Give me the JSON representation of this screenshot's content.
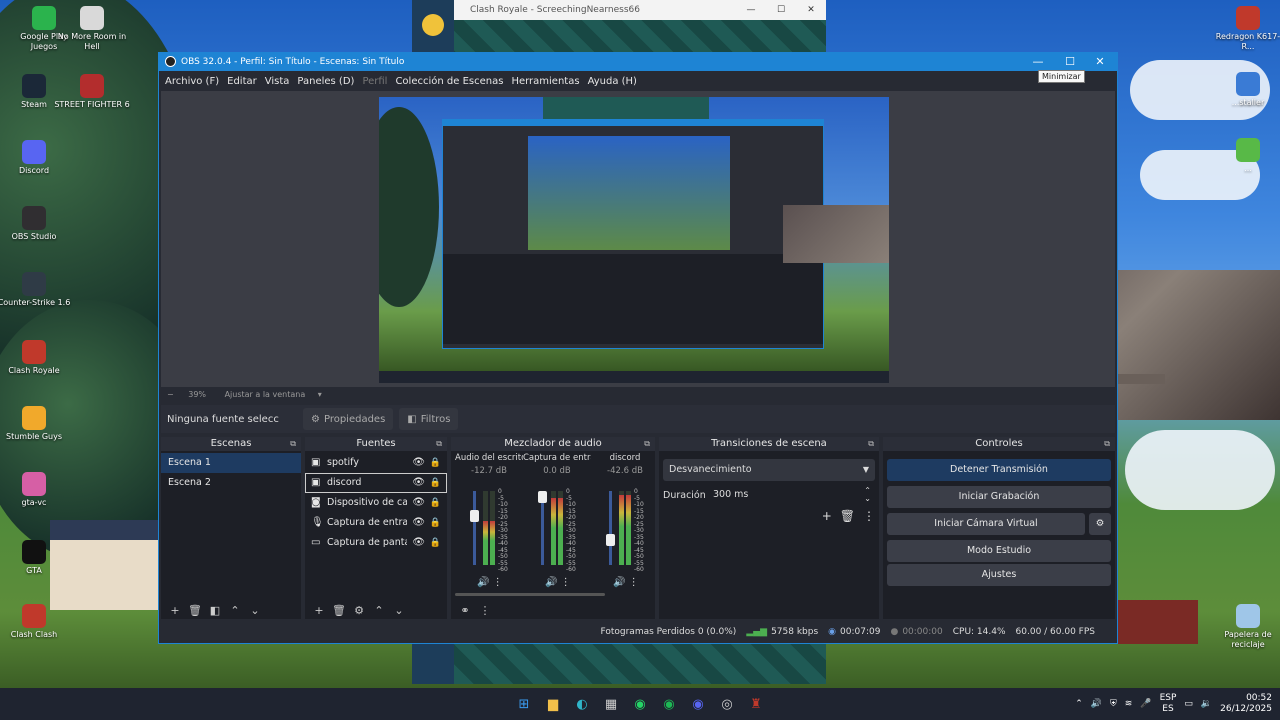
{
  "desktop": {
    "icons_left": [
      {
        "label": "Google Play Juegos",
        "icon": "google-play-games-icon",
        "color": "#2bb34d"
      },
      {
        "label": "No More Room in Hell",
        "icon": "nmrih-icon",
        "color": "#d9d9d9"
      },
      {
        "label": "Steam",
        "icon": "steam-icon",
        "color": "#1b2838"
      },
      {
        "label": "STREET FIGHTER 6",
        "icon": "street-fighter-icon",
        "color": "#b32d2d"
      },
      {
        "label": "Discord",
        "icon": "discord-icon",
        "color": "#5865f2"
      },
      {
        "label": "OBS Studio",
        "icon": "obs-icon",
        "color": "#302e31"
      },
      {
        "label": "Counter-Strike 1.6",
        "icon": "counter-strike-icon",
        "color": "#2f3b46"
      },
      {
        "label": "Clash Royale",
        "icon": "clash-royale-icon",
        "color": "#c0392b"
      },
      {
        "label": "Stumble Guys",
        "icon": "stumble-guys-icon",
        "color": "#f1a92b"
      },
      {
        "label": "gta-vc",
        "icon": "gta-vc-icon",
        "color": "#d65fa5"
      },
      {
        "label": "GTA",
        "icon": "gta-icon",
        "color": "#111111"
      },
      {
        "label": "Clash Clash",
        "icon": "clash-icon",
        "color": "#c0392b"
      }
    ],
    "icons_right": [
      {
        "label": "Redragon K617-R...",
        "icon": "redragon-icon",
        "color": "#c0392b"
      },
      {
        "label": "...staller",
        "icon": "installer-icon",
        "color": "#3a7bd5"
      },
      {
        "label": "...",
        "icon": "utorrent-icon",
        "color": "#58b947"
      },
      {
        "label": "Papelera de reciclaje",
        "icon": "recycle-bin-icon",
        "color": "#9fc6e8"
      }
    ]
  },
  "clash_window": {
    "title": "Clash Royale - ScreechingNearness66",
    "minimize": "—",
    "maximize": "☐",
    "close": "✕"
  },
  "obs": {
    "title": "OBS 32.0.4 - Perfil: Sin Título - Escenas: Sin Título",
    "window_buttons": {
      "minimize": "—",
      "maximize": "☐",
      "close": "✕"
    },
    "tooltip": "Minimizar",
    "menu": [
      "Archivo (F)",
      "Editar",
      "Vista",
      "Paneles (D)",
      "Perfil",
      "Colección de Escenas",
      "Herramientas",
      "Ayuda (H)"
    ],
    "zoom": {
      "minus": "−",
      "percent": "39%",
      "fit": "Ajustar a la ventana"
    },
    "source_toolbar": {
      "no_source": "Ninguna fuente seleccionada",
      "properties": "Propiedades",
      "filters": "Filtros"
    },
    "scenes": {
      "header": "Escenas",
      "items": [
        "Escena 1",
        "Escena 2"
      ],
      "selected": "Escena 1"
    },
    "sources": {
      "header": "Fuentes",
      "items": [
        {
          "label": "spotify",
          "icon": "window-capture-icon"
        },
        {
          "label": "discord",
          "icon": "window-capture-icon"
        },
        {
          "label": "Dispositivo de captura",
          "icon": "camera-icon"
        },
        {
          "label": "Captura de entrada de audio",
          "icon": "microphone-icon"
        },
        {
          "label": "Captura de pantalla",
          "icon": "monitor-icon"
        }
      ],
      "selected": "discord"
    },
    "mixer": {
      "header": "Mezclador de audio",
      "channels": [
        {
          "name": "Audio del escritorio",
          "db": "-12.7 dB",
          "level": 0.6,
          "fader": 0.7
        },
        {
          "name": "Captura de entrada",
          "db": "0.0 dB",
          "level": 0.9,
          "fader": 1.0
        },
        {
          "name": "discord",
          "db": "-42.6 dB",
          "level": 0.95,
          "fader": 0.3
        }
      ],
      "scale": [
        "0",
        "-5",
        "-10",
        "-15",
        "-20",
        "-25",
        "-30",
        "-35",
        "-40",
        "-45",
        "-50",
        "-55",
        "-60"
      ]
    },
    "transitions": {
      "header": "Transiciones de escena",
      "selected": "Desvanecimiento",
      "duration_label": "Duración",
      "duration_value": "300 ms"
    },
    "controls": {
      "header": "Controles",
      "stop_stream": "Detener Transmisión",
      "start_record": "Iniciar Grabación",
      "start_virtual_cam": "Iniciar Cámara Virtual",
      "studio_mode": "Modo Estudio",
      "settings": "Ajustes"
    },
    "status": {
      "dropped": "Fotogramas Perdidos 0 (0.0%)",
      "bitrate": "5758 kbps",
      "stream_time": "00:07:09",
      "record_time": "00:00:00",
      "cpu": "CPU: 14.4%",
      "fps": "60.00 / 60.00 FPS",
      "accent": "#4caf50"
    }
  },
  "taskbar": {
    "apps": [
      {
        "name": "start-icon",
        "glyph": "⊞",
        "color": "#3a9bf0"
      },
      {
        "name": "file-explorer-icon",
        "glyph": "▆",
        "color": "#f2c04a"
      },
      {
        "name": "edge-icon",
        "glyph": "◐",
        "color": "#2fb5c9"
      },
      {
        "name": "store-icon",
        "glyph": "▦",
        "color": "#d0d0d0"
      },
      {
        "name": "whatsapp-icon",
        "glyph": "◉",
        "color": "#25d366"
      },
      {
        "name": "spotify-icon",
        "glyph": "◉",
        "color": "#1db954"
      },
      {
        "name": "discord-icon",
        "glyph": "◉",
        "color": "#5865f2"
      },
      {
        "name": "obs-icon",
        "glyph": "◎",
        "color": "#cccccc"
      },
      {
        "name": "clash-royale-icon",
        "glyph": "♜",
        "color": "#c0392b"
      }
    ],
    "lang": "ESP",
    "lang_sub": "ES",
    "time": "00:52",
    "date": "26/12/2025"
  }
}
